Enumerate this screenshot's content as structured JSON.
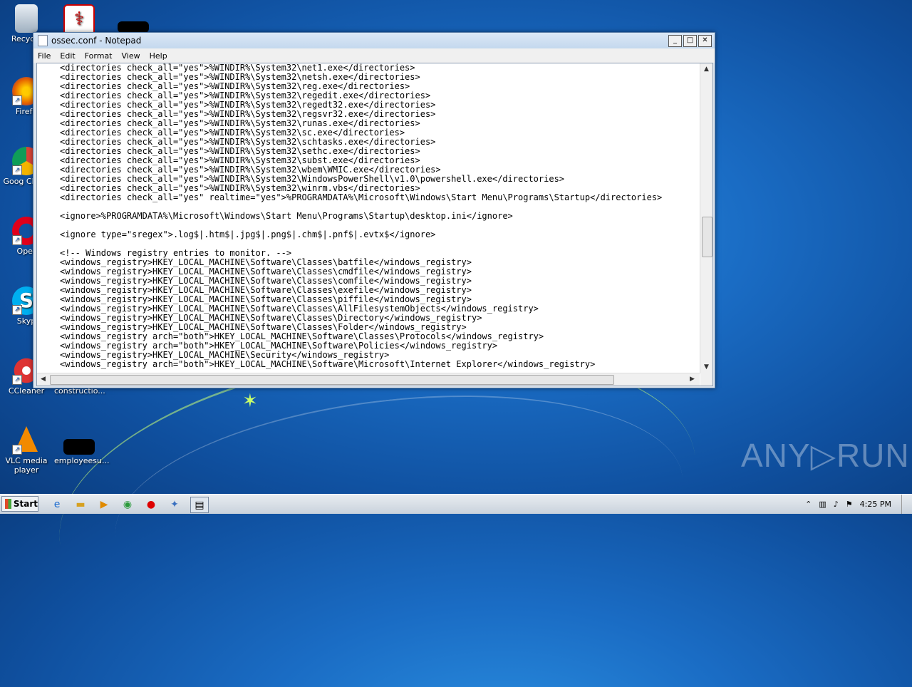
{
  "desktop": {
    "icons": [
      {
        "label": "Recycle"
      },
      {
        "label": "Firefo"
      },
      {
        "label": "Goog Chron"
      },
      {
        "label": "Oper"
      },
      {
        "label": "Skyp"
      },
      {
        "label": "CCleaner"
      },
      {
        "label": "constructio..."
      },
      {
        "label": "VLC media player"
      },
      {
        "label": "employeesu..."
      }
    ],
    "watermark": "ANY▷RUN"
  },
  "window": {
    "title": "ossec.conf - Notepad",
    "menu": [
      "File",
      "Edit",
      "Format",
      "View",
      "Help"
    ],
    "lines": [
      "<directories check_all=\"yes\">%WINDIR%\\System32\\net1.exe</directories>",
      "<directories check_all=\"yes\">%WINDIR%\\System32\\netsh.exe</directories>",
      "<directories check_all=\"yes\">%WINDIR%\\System32\\reg.exe</directories>",
      "<directories check_all=\"yes\">%WINDIR%\\System32\\regedit.exe</directories>",
      "<directories check_all=\"yes\">%WINDIR%\\System32\\regedt32.exe</directories>",
      "<directories check_all=\"yes\">%WINDIR%\\System32\\regsvr32.exe</directories>",
      "<directories check_all=\"yes\">%WINDIR%\\System32\\runas.exe</directories>",
      "<directories check_all=\"yes\">%WINDIR%\\System32\\sc.exe</directories>",
      "<directories check_all=\"yes\">%WINDIR%\\System32\\schtasks.exe</directories>",
      "<directories check_all=\"yes\">%WINDIR%\\System32\\sethc.exe</directories>",
      "<directories check_all=\"yes\">%WINDIR%\\System32\\subst.exe</directories>",
      "<directories check_all=\"yes\">%WINDIR%\\System32\\wbem\\WMIC.exe</directories>",
      "<directories check_all=\"yes\">%WINDIR%\\System32\\WindowsPowerShell\\v1.0\\powershell.exe</directories>",
      "<directories check_all=\"yes\">%WINDIR%\\System32\\winrm.vbs</directories>",
      "<directories check_all=\"yes\" realtime=\"yes\">%PROGRAMDATA%\\Microsoft\\Windows\\Start Menu\\Programs\\Startup</directories>",
      "",
      "<ignore>%PROGRAMDATA%\\Microsoft\\Windows\\Start Menu\\Programs\\Startup\\desktop.ini</ignore>",
      "",
      "<ignore type=\"sregex\">.log$|.htm$|.jpg$|.png$|.chm$|.pnf$|.evtx$</ignore>",
      "",
      "<!-- Windows registry entries to monitor. -->",
      "<windows_registry>HKEY_LOCAL_MACHINE\\Software\\Classes\\batfile</windows_registry>",
      "<windows_registry>HKEY_LOCAL_MACHINE\\Software\\Classes\\cmdfile</windows_registry>",
      "<windows_registry>HKEY_LOCAL_MACHINE\\Software\\Classes\\comfile</windows_registry>",
      "<windows_registry>HKEY_LOCAL_MACHINE\\Software\\Classes\\exefile</windows_registry>",
      "<windows_registry>HKEY_LOCAL_MACHINE\\Software\\Classes\\piffile</windows_registry>",
      "<windows_registry>HKEY_LOCAL_MACHINE\\Software\\Classes\\AllFilesystemObjects</windows_registry>",
      "<windows_registry>HKEY_LOCAL_MACHINE\\Software\\Classes\\Directory</windows_registry>",
      "<windows_registry>HKEY_LOCAL_MACHINE\\Software\\Classes\\Folder</windows_registry>",
      "<windows_registry arch=\"both\">HKEY_LOCAL_MACHINE\\Software\\Classes\\Protocols</windows_registry>",
      "<windows_registry arch=\"both\">HKEY_LOCAL_MACHINE\\Software\\Policies</windows_registry>",
      "<windows_registry>HKEY_LOCAL_MACHINE\\Security</windows_registry>",
      "<windows_registry arch=\"both\">HKEY_LOCAL_MACHINE\\Software\\Microsoft\\Internet Explorer</windows_registry>"
    ]
  },
  "taskbar": {
    "start_label": "Start",
    "clock": "4:25 PM"
  }
}
